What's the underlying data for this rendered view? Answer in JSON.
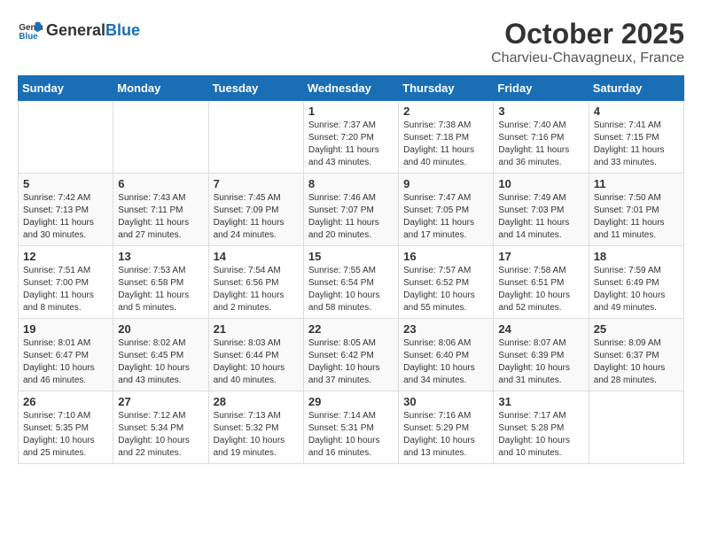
{
  "header": {
    "logo_general": "General",
    "logo_blue": "Blue",
    "month": "October 2025",
    "location": "Charvieu-Chavagneux, France"
  },
  "weekdays": [
    "Sunday",
    "Monday",
    "Tuesday",
    "Wednesday",
    "Thursday",
    "Friday",
    "Saturday"
  ],
  "weeks": [
    [
      {
        "day": "",
        "info": ""
      },
      {
        "day": "",
        "info": ""
      },
      {
        "day": "",
        "info": ""
      },
      {
        "day": "1",
        "info": "Sunrise: 7:37 AM\nSunset: 7:20 PM\nDaylight: 11 hours\nand 43 minutes."
      },
      {
        "day": "2",
        "info": "Sunrise: 7:38 AM\nSunset: 7:18 PM\nDaylight: 11 hours\nand 40 minutes."
      },
      {
        "day": "3",
        "info": "Sunrise: 7:40 AM\nSunset: 7:16 PM\nDaylight: 11 hours\nand 36 minutes."
      },
      {
        "day": "4",
        "info": "Sunrise: 7:41 AM\nSunset: 7:15 PM\nDaylight: 11 hours\nand 33 minutes."
      }
    ],
    [
      {
        "day": "5",
        "info": "Sunrise: 7:42 AM\nSunset: 7:13 PM\nDaylight: 11 hours\nand 30 minutes."
      },
      {
        "day": "6",
        "info": "Sunrise: 7:43 AM\nSunset: 7:11 PM\nDaylight: 11 hours\nand 27 minutes."
      },
      {
        "day": "7",
        "info": "Sunrise: 7:45 AM\nSunset: 7:09 PM\nDaylight: 11 hours\nand 24 minutes."
      },
      {
        "day": "8",
        "info": "Sunrise: 7:46 AM\nSunset: 7:07 PM\nDaylight: 11 hours\nand 20 minutes."
      },
      {
        "day": "9",
        "info": "Sunrise: 7:47 AM\nSunset: 7:05 PM\nDaylight: 11 hours\nand 17 minutes."
      },
      {
        "day": "10",
        "info": "Sunrise: 7:49 AM\nSunset: 7:03 PM\nDaylight: 11 hours\nand 14 minutes."
      },
      {
        "day": "11",
        "info": "Sunrise: 7:50 AM\nSunset: 7:01 PM\nDaylight: 11 hours\nand 11 minutes."
      }
    ],
    [
      {
        "day": "12",
        "info": "Sunrise: 7:51 AM\nSunset: 7:00 PM\nDaylight: 11 hours\nand 8 minutes."
      },
      {
        "day": "13",
        "info": "Sunrise: 7:53 AM\nSunset: 6:58 PM\nDaylight: 11 hours\nand 5 minutes."
      },
      {
        "day": "14",
        "info": "Sunrise: 7:54 AM\nSunset: 6:56 PM\nDaylight: 11 hours\nand 2 minutes."
      },
      {
        "day": "15",
        "info": "Sunrise: 7:55 AM\nSunset: 6:54 PM\nDaylight: 10 hours\nand 58 minutes."
      },
      {
        "day": "16",
        "info": "Sunrise: 7:57 AM\nSunset: 6:52 PM\nDaylight: 10 hours\nand 55 minutes."
      },
      {
        "day": "17",
        "info": "Sunrise: 7:58 AM\nSunset: 6:51 PM\nDaylight: 10 hours\nand 52 minutes."
      },
      {
        "day": "18",
        "info": "Sunrise: 7:59 AM\nSunset: 6:49 PM\nDaylight: 10 hours\nand 49 minutes."
      }
    ],
    [
      {
        "day": "19",
        "info": "Sunrise: 8:01 AM\nSunset: 6:47 PM\nDaylight: 10 hours\nand 46 minutes."
      },
      {
        "day": "20",
        "info": "Sunrise: 8:02 AM\nSunset: 6:45 PM\nDaylight: 10 hours\nand 43 minutes."
      },
      {
        "day": "21",
        "info": "Sunrise: 8:03 AM\nSunset: 6:44 PM\nDaylight: 10 hours\nand 40 minutes."
      },
      {
        "day": "22",
        "info": "Sunrise: 8:05 AM\nSunset: 6:42 PM\nDaylight: 10 hours\nand 37 minutes."
      },
      {
        "day": "23",
        "info": "Sunrise: 8:06 AM\nSunset: 6:40 PM\nDaylight: 10 hours\nand 34 minutes."
      },
      {
        "day": "24",
        "info": "Sunrise: 8:07 AM\nSunset: 6:39 PM\nDaylight: 10 hours\nand 31 minutes."
      },
      {
        "day": "25",
        "info": "Sunrise: 8:09 AM\nSunset: 6:37 PM\nDaylight: 10 hours\nand 28 minutes."
      }
    ],
    [
      {
        "day": "26",
        "info": "Sunrise: 7:10 AM\nSunset: 5:35 PM\nDaylight: 10 hours\nand 25 minutes."
      },
      {
        "day": "27",
        "info": "Sunrise: 7:12 AM\nSunset: 5:34 PM\nDaylight: 10 hours\nand 22 minutes."
      },
      {
        "day": "28",
        "info": "Sunrise: 7:13 AM\nSunset: 5:32 PM\nDaylight: 10 hours\nand 19 minutes."
      },
      {
        "day": "29",
        "info": "Sunrise: 7:14 AM\nSunset: 5:31 PM\nDaylight: 10 hours\nand 16 minutes."
      },
      {
        "day": "30",
        "info": "Sunrise: 7:16 AM\nSunset: 5:29 PM\nDaylight: 10 hours\nand 13 minutes."
      },
      {
        "day": "31",
        "info": "Sunrise: 7:17 AM\nSunset: 5:28 PM\nDaylight: 10 hours\nand 10 minutes."
      },
      {
        "day": "",
        "info": ""
      }
    ]
  ]
}
